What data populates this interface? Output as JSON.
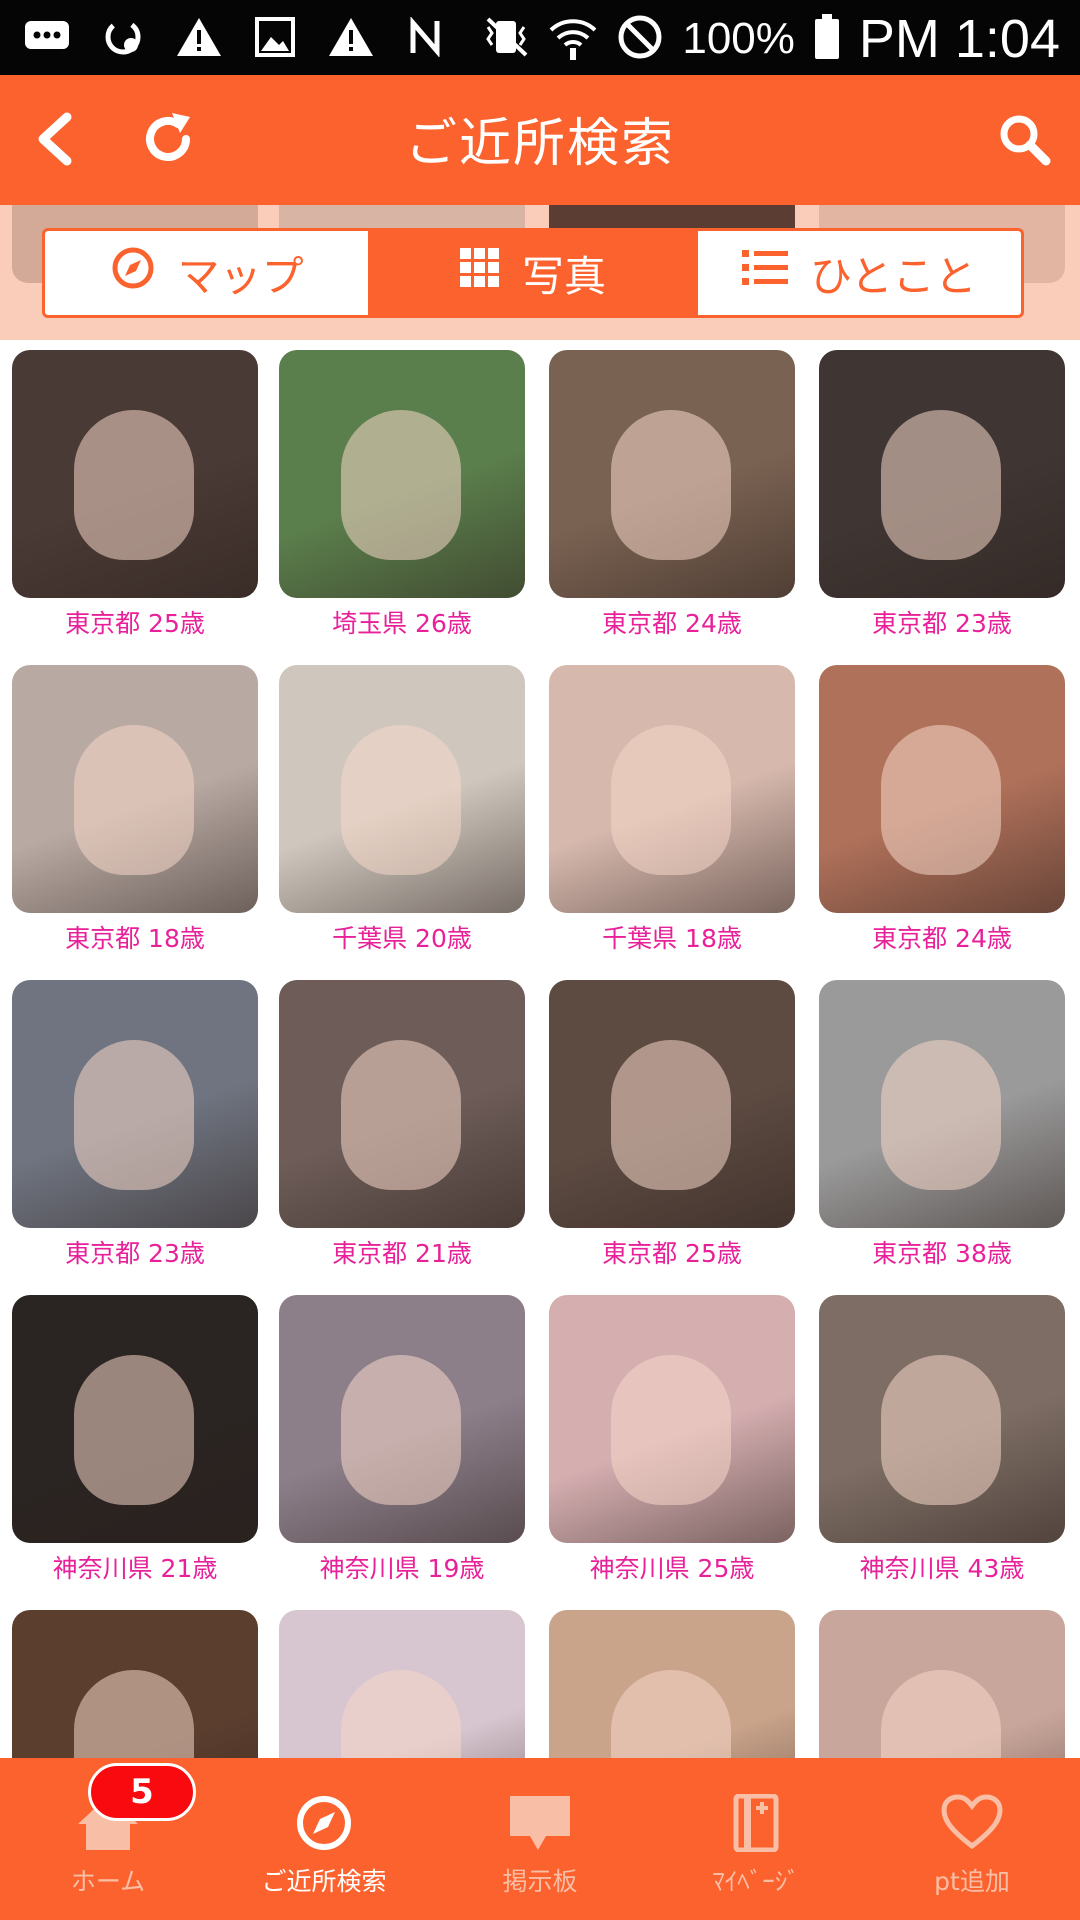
{
  "status_bar": {
    "icons": [
      "message-icon",
      "sync-icon",
      "warning-icon",
      "image-icon",
      "warning-icon",
      "nfc-icon"
    ],
    "right_icons": [
      "vibrate-icon",
      "wifi-icon",
      "block-icon"
    ],
    "battery_text": "100%",
    "time": "PM 1:04"
  },
  "header": {
    "title": "ご近所検索",
    "back_icon": "back-icon",
    "refresh_icon": "refresh-icon",
    "search_icon": "search-icon"
  },
  "tabs": [
    {
      "label": "マップ",
      "icon": "compass-icon",
      "active": false
    },
    {
      "label": "写真",
      "icon": "grid-icon",
      "active": true
    },
    {
      "label": "ひとこと",
      "icon": "list-icon",
      "active": false
    }
  ],
  "profiles": [
    {
      "label": "東京都 25歳",
      "bg": "#4a3a35"
    },
    {
      "label": "埼玉県 26歳",
      "bg": "#5b7f4c"
    },
    {
      "label": "東京都 24歳",
      "bg": "#7a6252"
    },
    {
      "label": "東京都 23歳",
      "bg": "#3f3633"
    },
    {
      "label": "東京都 18歳",
      "bg": "#b8a9a2"
    },
    {
      "label": "千葉県 20歳",
      "bg": "#cfc7be"
    },
    {
      "label": "千葉県 18歳",
      "bg": "#d6b8ad"
    },
    {
      "label": "東京都 24歳",
      "bg": "#b0715a"
    },
    {
      "label": "東京都 23歳",
      "bg": "#6f7480"
    },
    {
      "label": "東京都 21歳",
      "bg": "#6d5c58"
    },
    {
      "label": "東京都 25歳",
      "bg": "#5d4b42"
    },
    {
      "label": "東京都 38歳",
      "bg": "#9a9a9a"
    },
    {
      "label": "神奈川県 21歳",
      "bg": "#2a2422"
    },
    {
      "label": "神奈川県 19歳",
      "bg": "#8d7f8a"
    },
    {
      "label": "神奈川県 25歳",
      "bg": "#d5aeb0"
    },
    {
      "label": "神奈川県 43歳",
      "bg": "#7d6d64"
    },
    {
      "label": "",
      "bg": "#5b3e2e"
    },
    {
      "label": "",
      "bg": "#d7c5cf"
    },
    {
      "label": "",
      "bg": "#c9a38a"
    },
    {
      "label": "",
      "bg": "#c9a69b"
    }
  ],
  "bottom_nav": [
    {
      "label": "ホーム",
      "icon": "home-icon",
      "active": false,
      "badge": "5"
    },
    {
      "label": "ご近所検索",
      "icon": "compass-icon",
      "active": true
    },
    {
      "label": "掲示板",
      "icon": "chat-bubble-icon",
      "active": false
    },
    {
      "label": "ﾏｲﾍﾞｰｼﾞ",
      "icon": "book-icon",
      "active": false
    },
    {
      "label": "pt追加",
      "icon": "heart-icon",
      "active": false
    }
  ],
  "colors": {
    "accent": "#fb622d",
    "caption": "#e8219a",
    "badge": "#f80a0f"
  }
}
